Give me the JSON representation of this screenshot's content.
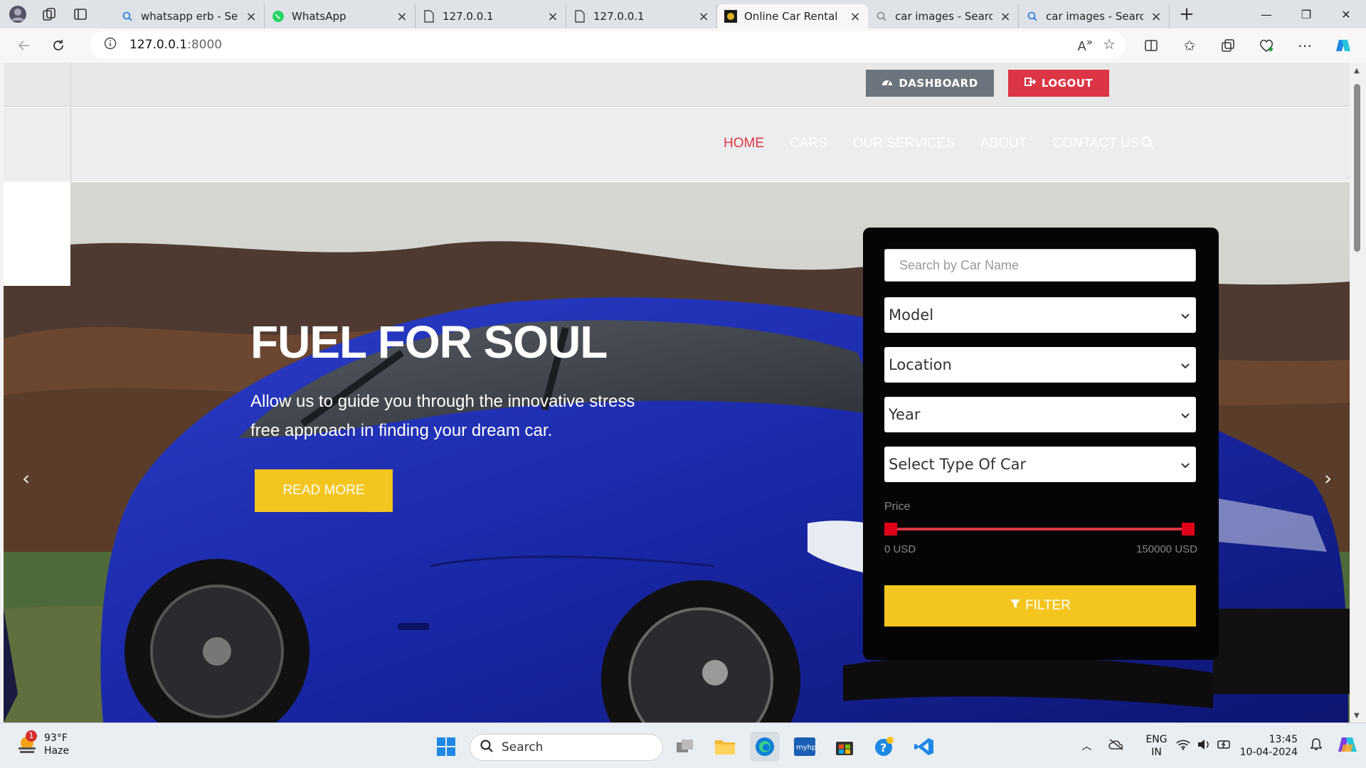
{
  "browser": {
    "tabs": [
      {
        "title": "whatsapp erb - Sear",
        "icon": "search-icon"
      },
      {
        "title": "WhatsApp",
        "icon": "whatsapp-icon"
      },
      {
        "title": "127.0.0.1",
        "icon": "page-icon"
      },
      {
        "title": "127.0.0.1",
        "icon": "page-icon"
      },
      {
        "title": "Online Car Rental | I",
        "icon": "site-logo-icon",
        "active": true
      },
      {
        "title": "car images - Search",
        "icon": "search-icon"
      },
      {
        "title": "car images - Search",
        "icon": "search-icon"
      }
    ],
    "url_host": "127.0.0.1",
    "url_port": ":8000"
  },
  "site": {
    "dashboard_label": "DASHBOARD",
    "logout_label": "LOGOUT",
    "nav": [
      "HOME",
      "CARS",
      "OUR SERVICES",
      "ABOUT",
      "CONTACT US"
    ],
    "active_nav": "HOME",
    "hero": {
      "title": "FUEL FOR SOUL",
      "text": "Allow us to guide you through the innovative stress free approach in finding your dream car.",
      "button": "READ MORE"
    },
    "search": {
      "placeholder": "Search by Car Name",
      "model": "Model",
      "location": "Location",
      "year": "Year",
      "type": "Select Type Of Car",
      "price_label": "Price",
      "price_min": "0 USD",
      "price_max": "150000 USD",
      "filter_label": "FILTER"
    }
  },
  "colors": {
    "accent_red": "#dc3545",
    "accent_yellow": "#f4c51e",
    "panel": "#050505",
    "dashboard_btn": "#6c757d"
  },
  "taskbar": {
    "temperature": "93°F",
    "condition": "Haze",
    "weather_badge": "1",
    "search_label": "Search",
    "lang_1": "ENG",
    "lang_2": "IN",
    "time": "13:45",
    "date": "10-04-2024"
  }
}
